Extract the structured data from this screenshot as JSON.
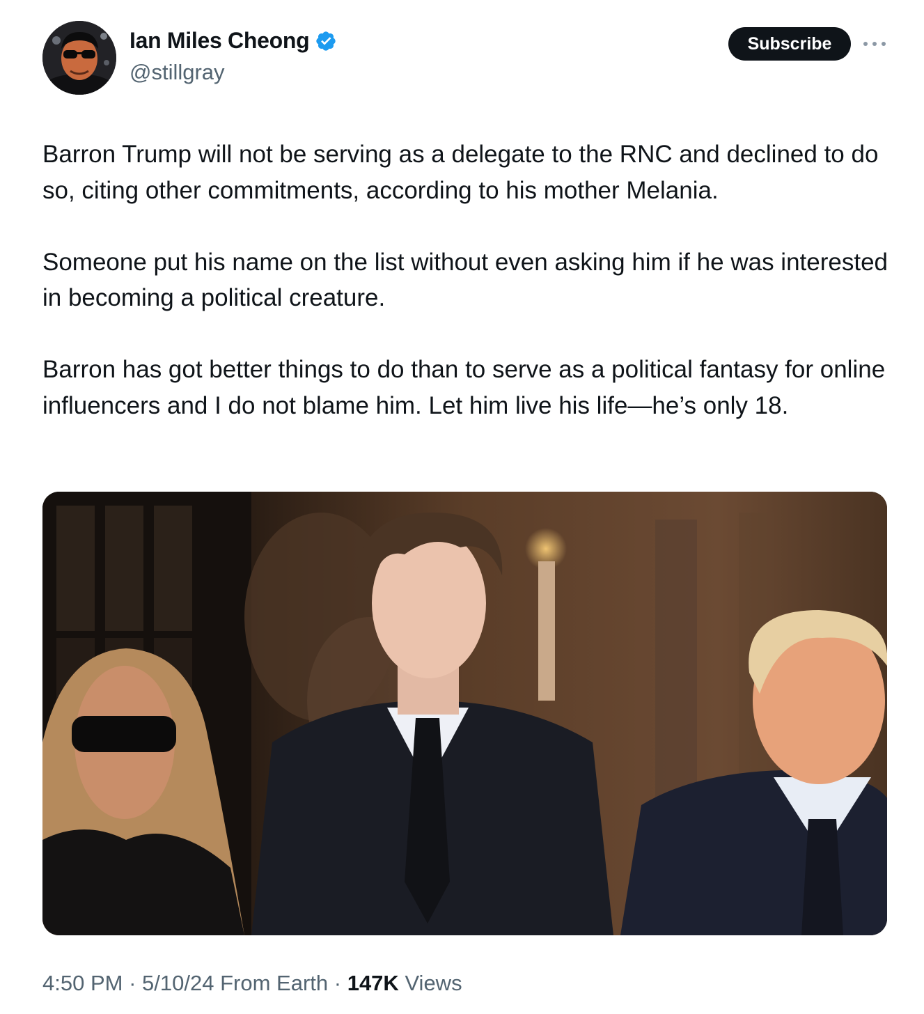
{
  "author": {
    "display_name": "Ian Miles Cheong",
    "handle": "@stillgray",
    "verified": true
  },
  "actions": {
    "subscribe_label": "Subscribe"
  },
  "tweet": {
    "paragraphs": [
      "Barron Trump will not be serving as a delegate to the RNC and declined to do so, citing other commitments, according to his mother Melania.",
      "Someone put his name on the list without even asking him if he was interested in becoming a political creature.",
      "Barron has got better things to do than to serve as a political fantasy for online influencers and I do not blame him. Let him live his life—he’s only 18."
    ]
  },
  "meta": {
    "time": "4:50 PM",
    "date": "5/10/24",
    "source": "From Earth",
    "views_count": "147K",
    "views_label": "Views",
    "separator": "·"
  },
  "colors": {
    "text_primary": "#0f1419",
    "text_secondary": "#536471",
    "verified_blue": "#1d9bf0",
    "button_bg": "#0f1419"
  }
}
